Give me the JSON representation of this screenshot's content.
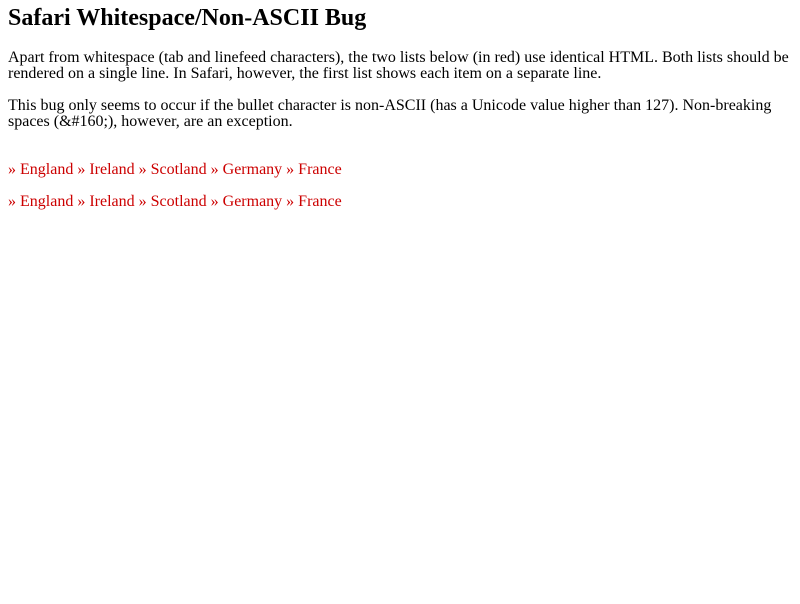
{
  "title": "Safari Whitespace/Non-ASCII Bug",
  "paragraphs": [
    "Apart from whitespace (tab and linefeed characters), the two lists below (in red) use identical HTML. Both lists should be rendered on a single line. In Safari, however, the first list shows each item on a separate line.",
    "This bug only seems to occur if the bullet character is non-ASCII (has a Unicode value higher than 127). Non-breaking spaces (&#160;), however, are an exception."
  ],
  "bullet": "»",
  "lists": [
    {
      "items": [
        "England",
        "Ireland",
        "Scotland",
        "Germany",
        "France"
      ]
    },
    {
      "items": [
        "England",
        "Ireland",
        "Scotland",
        "Germany",
        "France"
      ]
    }
  ],
  "colors": {
    "list_text": "#cc0000",
    "body_text": "#000000",
    "background": "#ffffff"
  }
}
